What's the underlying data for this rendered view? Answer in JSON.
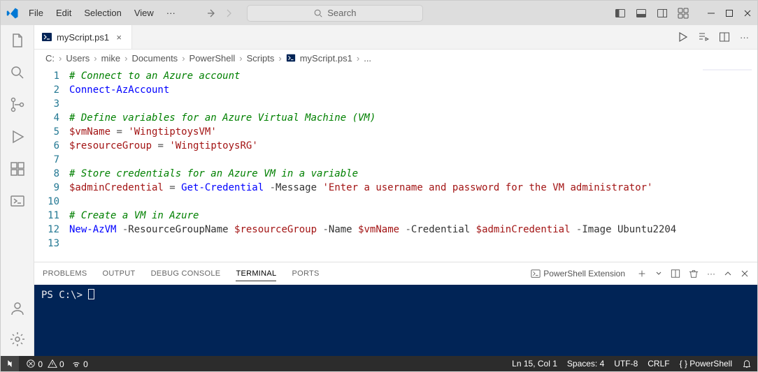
{
  "titlebar": {
    "menu": [
      "File",
      "Edit",
      "Selection",
      "View"
    ],
    "search_placeholder": "Search"
  },
  "tab": {
    "filename": "myScript.ps1"
  },
  "breadcrumbs": {
    "segments": [
      "C:",
      "Users",
      "mike",
      "Documents",
      "PowerShell",
      "Scripts"
    ],
    "file": "myScript.ps1",
    "tail": "..."
  },
  "code": {
    "lines": [
      {
        "num": 1,
        "tokens": [
          {
            "t": "# Connect to an Azure account",
            "c": "comment"
          }
        ]
      },
      {
        "num": 2,
        "tokens": [
          {
            "t": "Connect-AzAccount",
            "c": "cmdlet"
          }
        ]
      },
      {
        "num": 3,
        "tokens": []
      },
      {
        "num": 4,
        "tokens": [
          {
            "t": "# Define variables for an Azure Virtual Machine (VM)",
            "c": "comment"
          }
        ]
      },
      {
        "num": 5,
        "tokens": [
          {
            "t": "$vmName",
            "c": "var"
          },
          {
            "t": " = ",
            "c": "op"
          },
          {
            "t": "'WingtiptoysVM'",
            "c": "string"
          }
        ]
      },
      {
        "num": 6,
        "tokens": [
          {
            "t": "$resourceGroup",
            "c": "var"
          },
          {
            "t": " = ",
            "c": "op"
          },
          {
            "t": "'WingtiptoysRG'",
            "c": "string"
          }
        ]
      },
      {
        "num": 7,
        "tokens": []
      },
      {
        "num": 8,
        "tokens": [
          {
            "t": "# Store credentials for an Azure VM in a variable",
            "c": "comment"
          }
        ]
      },
      {
        "num": 9,
        "tokens": [
          {
            "t": "$adminCredential",
            "c": "var"
          },
          {
            "t": " = ",
            "c": "op"
          },
          {
            "t": "Get-Credential",
            "c": "cmdlet"
          },
          {
            "t": " -",
            "c": "op"
          },
          {
            "t": "Message ",
            "c": "param"
          },
          {
            "t": "'Enter a username and password for the VM administrator'",
            "c": "string"
          }
        ]
      },
      {
        "num": 10,
        "tokens": []
      },
      {
        "num": 11,
        "tokens": [
          {
            "t": "# Create a VM in Azure",
            "c": "comment"
          }
        ]
      },
      {
        "num": 12,
        "tokens": [
          {
            "t": "New-AzVM",
            "c": "cmdlet"
          },
          {
            "t": " -",
            "c": "op"
          },
          {
            "t": "ResourceGroupName ",
            "c": "param"
          },
          {
            "t": "$resourceGroup",
            "c": "var"
          },
          {
            "t": " -",
            "c": "op"
          },
          {
            "t": "Name ",
            "c": "param"
          },
          {
            "t": "$vmName",
            "c": "var"
          },
          {
            "t": " -",
            "c": "op"
          },
          {
            "t": "Credential ",
            "c": "param"
          },
          {
            "t": "$adminCredential",
            "c": "var"
          },
          {
            "t": " -",
            "c": "op"
          },
          {
            "t": "Image ",
            "c": "param"
          },
          {
            "t": "Ubuntu2204",
            "c": "param"
          }
        ]
      },
      {
        "num": 13,
        "tokens": []
      }
    ]
  },
  "panel": {
    "tabs": [
      "PROBLEMS",
      "OUTPUT",
      "DEBUG CONSOLE",
      "TERMINAL",
      "PORTS"
    ],
    "active": "TERMINAL",
    "shell_label": "PowerShell Extension",
    "prompt": "PS C:\\> "
  },
  "statusbar": {
    "errors": "0",
    "warnings": "0",
    "ports": "0",
    "cursor": "Ln 15, Col 1",
    "spaces": "Spaces: 4",
    "encoding": "UTF-8",
    "eol": "CRLF",
    "language": "PowerShell"
  }
}
